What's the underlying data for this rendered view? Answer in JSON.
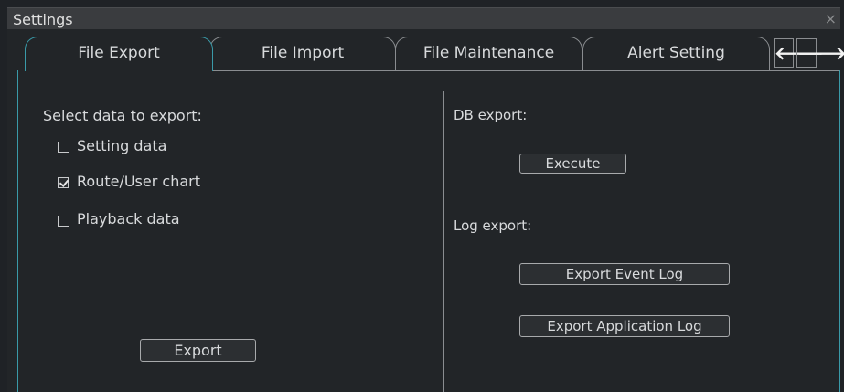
{
  "window": {
    "title": "Settings",
    "close_icon": "×"
  },
  "tabs": [
    {
      "label": "File Export",
      "active": true
    },
    {
      "label": "File Import",
      "active": false
    },
    {
      "label": "File Maintenance",
      "active": false
    },
    {
      "label": "Alert Setting",
      "active": false
    }
  ],
  "nav": {
    "left_arrow": "🡐",
    "right_arrow": "🡒"
  },
  "export_panel": {
    "heading": "Select data to export:",
    "options": [
      {
        "label": "Setting data",
        "checked": false
      },
      {
        "label": "Route/User chart",
        "checked": true
      },
      {
        "label": "Playback data",
        "checked": false
      }
    ],
    "export_button": "Export"
  },
  "db_export": {
    "heading": "DB export:",
    "execute_button": "Execute"
  },
  "log_export": {
    "heading": "Log export:",
    "event_log_button": "Export Event Log",
    "app_log_button": "Export Application Log"
  },
  "colors": {
    "accent": "#3a9aa8",
    "background": "#222528",
    "titlebar": "#3a3c3f"
  }
}
